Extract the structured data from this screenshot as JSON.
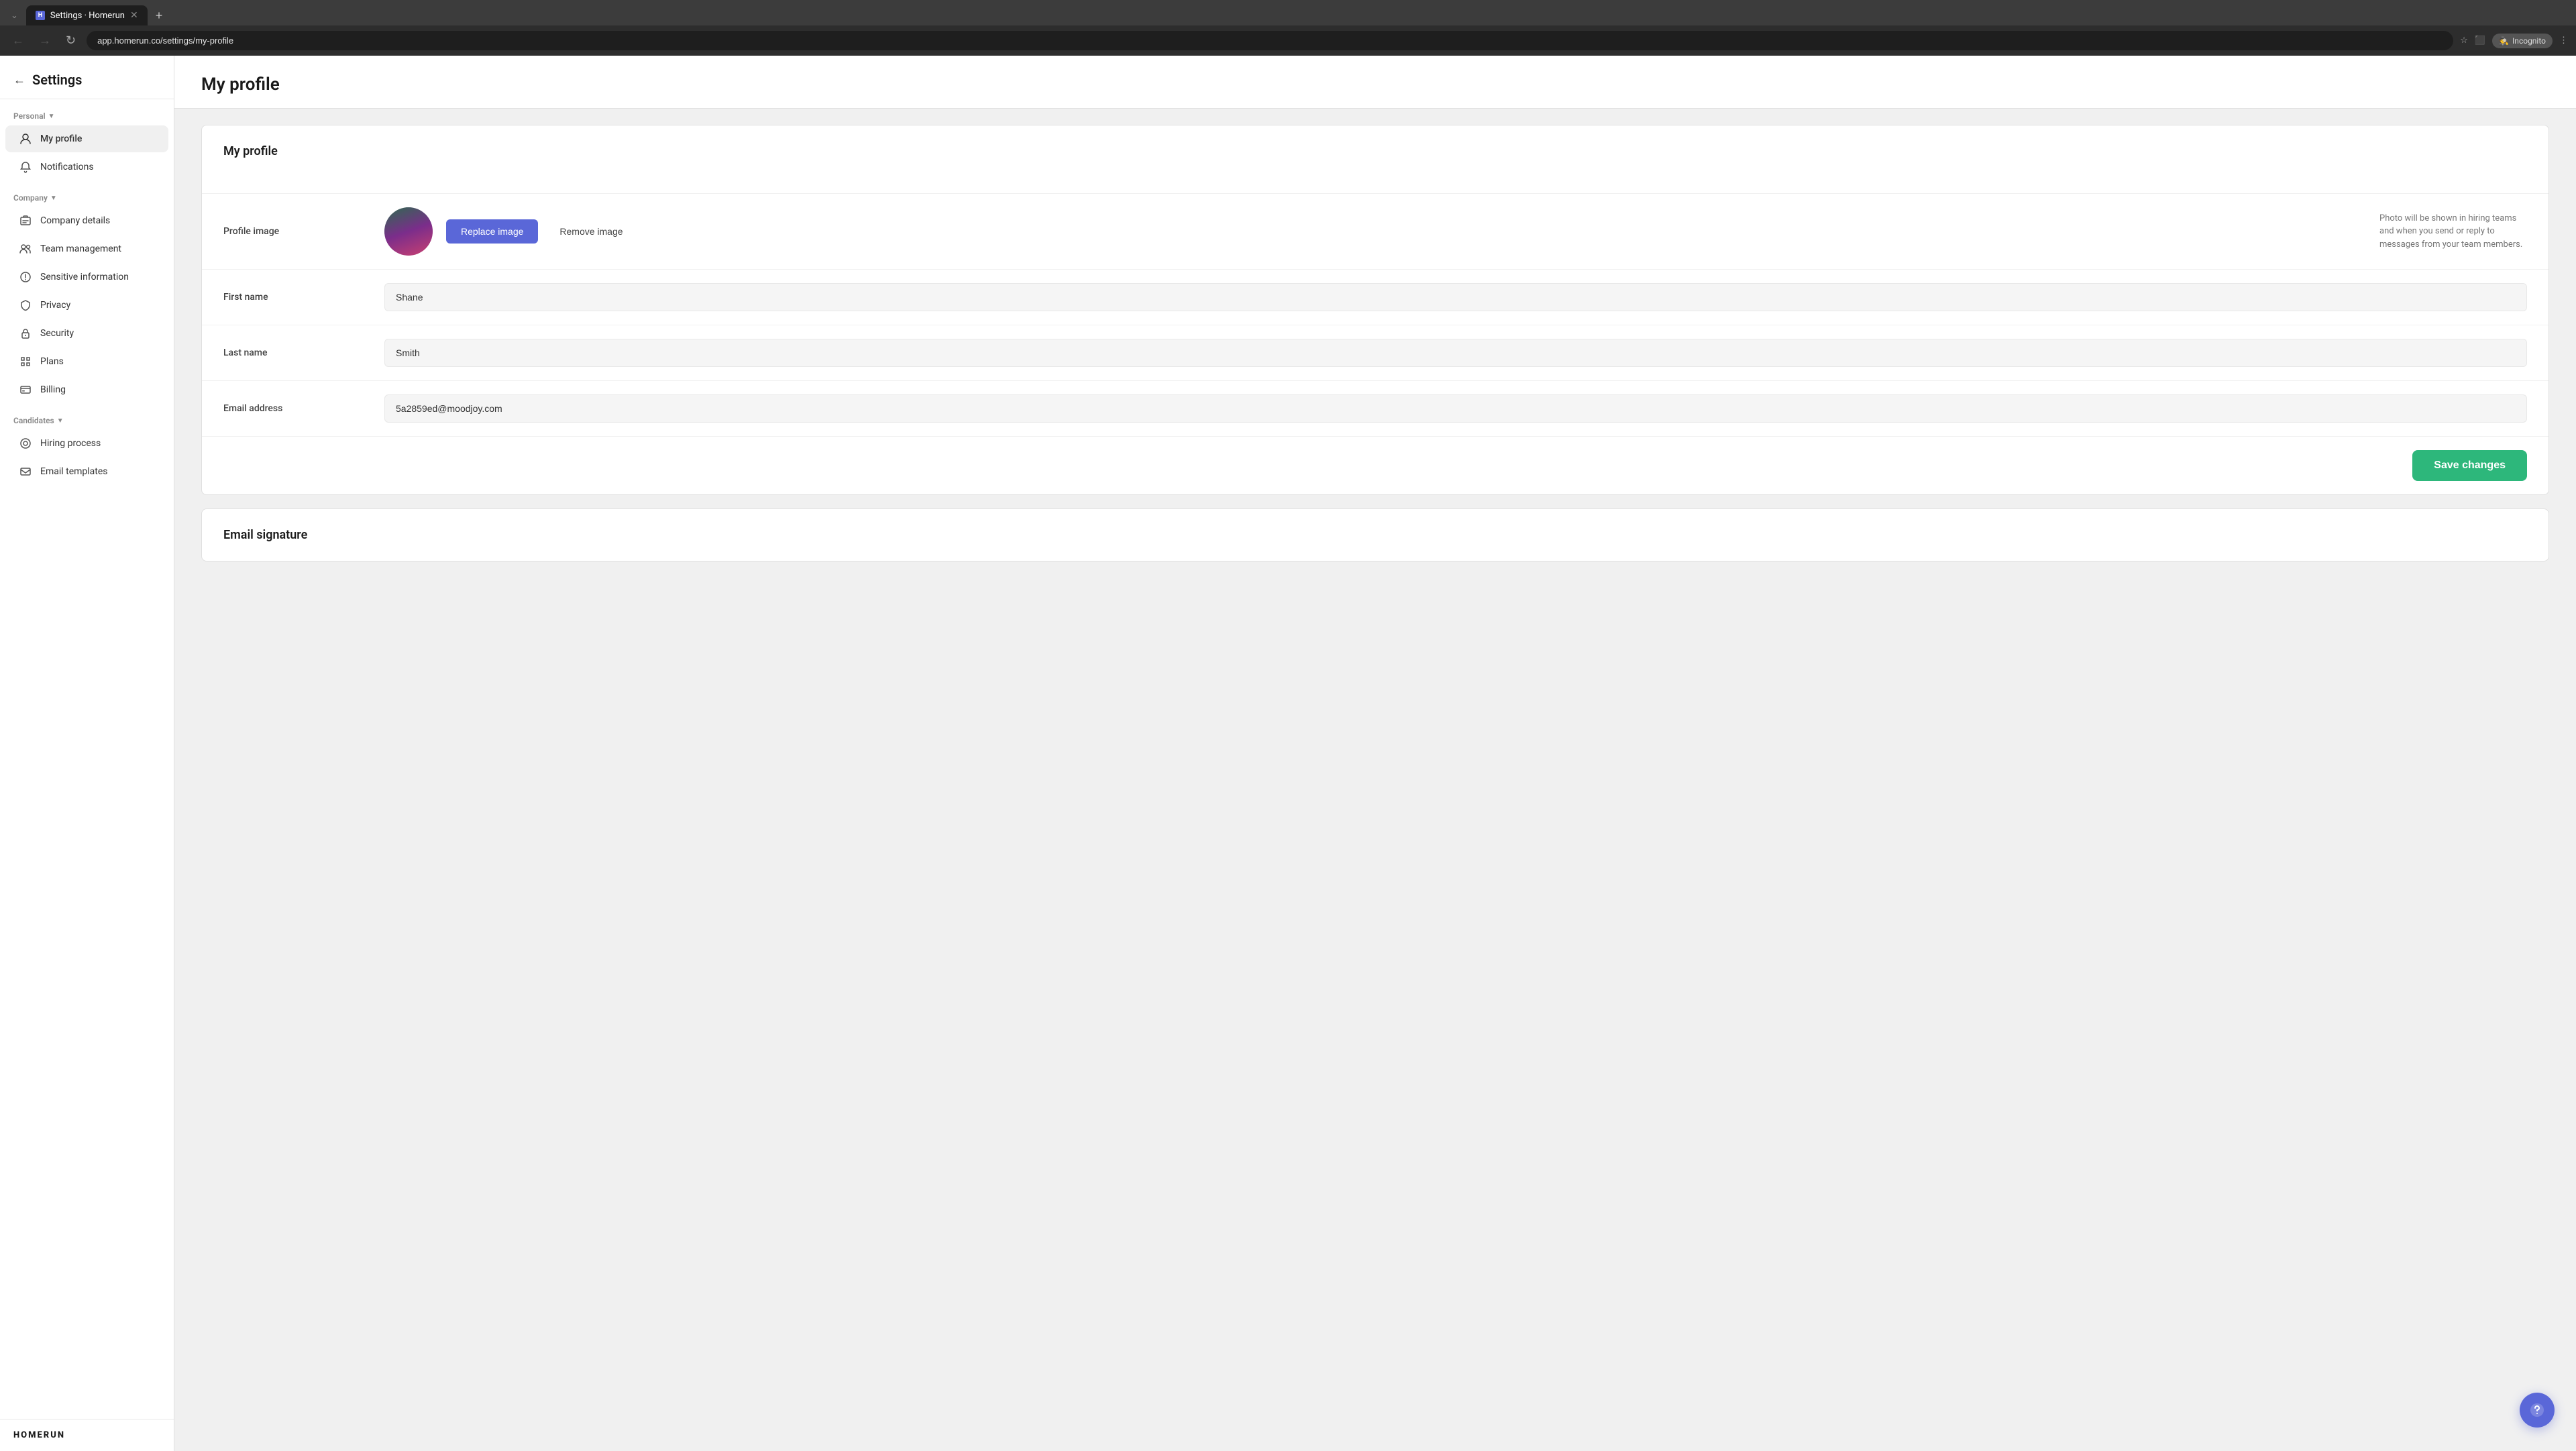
{
  "browser": {
    "tab_label": "Settings · Homerun",
    "favicon_letter": "H",
    "url": "app.homerun.co/settings/my-profile",
    "incognito_label": "Incognito",
    "new_tab_symbol": "+"
  },
  "settings": {
    "back_label": "←",
    "title": "Settings"
  },
  "sidebar": {
    "personal_label": "Personal",
    "company_label": "Company",
    "candidates_label": "Candidates",
    "items": {
      "my_profile": "My profile",
      "notifications": "Notifications",
      "company_details": "Company details",
      "team_management": "Team management",
      "sensitive_information": "Sensitive information",
      "privacy": "Privacy",
      "security": "Security",
      "plans": "Plans",
      "billing": "Billing",
      "hiring_process": "Hiring process",
      "email_templates": "Email templates"
    },
    "logo": "HOMERUN"
  },
  "page": {
    "title": "My profile",
    "card_title": "My profile"
  },
  "profile_image": {
    "label": "Profile image",
    "replace_btn": "Replace image",
    "remove_btn": "Remove image",
    "hint": "Photo will be shown in hiring teams and when you send or reply to messages from your team members."
  },
  "form": {
    "first_name_label": "First name",
    "first_name_value": "Shane",
    "last_name_label": "Last name",
    "last_name_value": "Smith",
    "email_label": "Email address",
    "email_value": "5a2859ed@moodjoy.com"
  },
  "actions": {
    "save_changes": "Save changes"
  },
  "email_signature": {
    "title": "Email signature"
  }
}
